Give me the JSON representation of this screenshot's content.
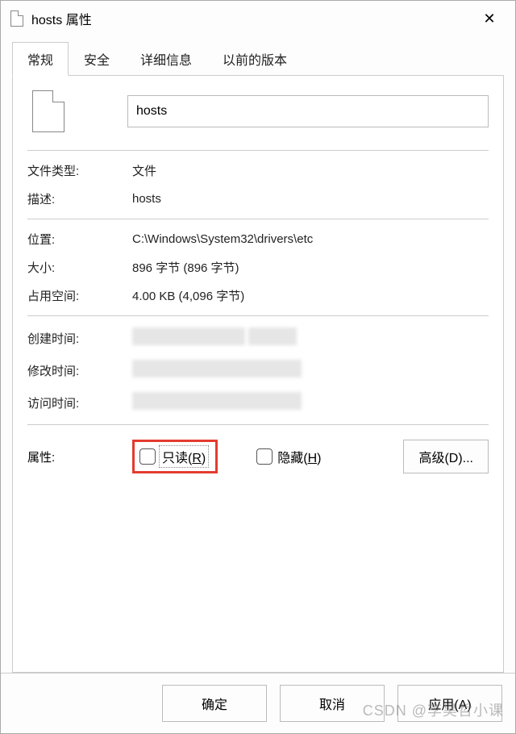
{
  "window": {
    "title": "hosts 属性",
    "close_glyph": "✕"
  },
  "tabs": [
    "常规",
    "安全",
    "详细信息",
    "以前的版本"
  ],
  "general": {
    "filename": "hosts",
    "labels": {
      "filetype": "文件类型:",
      "description": "描述:",
      "location": "位置:",
      "size": "大小:",
      "size_on_disk": "占用空间:",
      "created": "创建时间:",
      "modified": "修改时间:",
      "accessed": "访问时间:",
      "attributes": "属性:"
    },
    "values": {
      "filetype": "文件",
      "description": "hosts",
      "location": "C:\\Windows\\System32\\drivers\\etc",
      "size": "896 字节 (896 字节)",
      "size_on_disk": "4.00 KB (4,096 字节)"
    },
    "readonly_label_pre": "只读(",
    "readonly_hotkey": "R",
    "readonly_label_post": ")",
    "hidden_label_pre": "隐藏(",
    "hidden_hotkey": "H",
    "hidden_label_post": ")",
    "advanced_label": "高级(D)..."
  },
  "footer": {
    "ok": "确定",
    "cancel": "取消",
    "apply": "应用(A)"
  },
  "watermark": "CSDN @李昊哲小课"
}
